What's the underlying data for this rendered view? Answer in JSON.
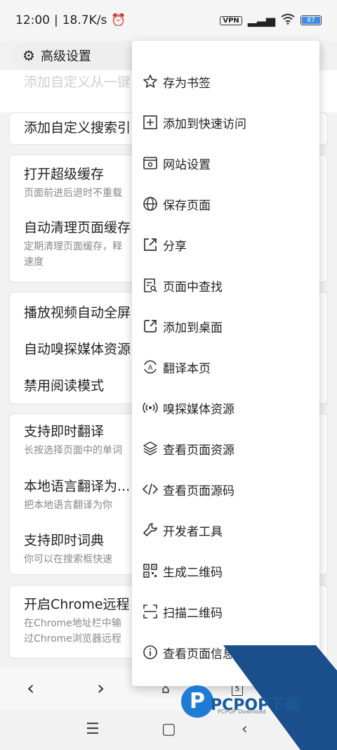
{
  "status": {
    "time": "12:00",
    "net_speed": "18.7K/s",
    "vpn": "VPN",
    "battery": "87"
  },
  "header": {
    "title": "高级设置"
  },
  "behind_text": "添加自定义从一键",
  "settings": {
    "add_search": {
      "title": "添加自定义搜索引"
    },
    "super_cache": {
      "title": "打开超级缓存",
      "sub": "页面前进后退时不重载"
    },
    "auto_clean": {
      "title": "自动清理页面缓存",
      "sub1": "定期清理页面缓存，释",
      "sub2": "速度"
    },
    "fullscreen": {
      "title": "播放视频自动全屏"
    },
    "sniff": {
      "title": "自动嗅探媒体资源"
    },
    "reader": {
      "title": "禁用阅读模式"
    },
    "instant_translate": {
      "title": "支持即时翻译",
      "sub": "长按选择页面中的单词"
    },
    "local_translate": {
      "title": "本地语言翻译为...",
      "sub": "把本地语言翻译为你"
    },
    "dictionary": {
      "title": "支持即时词典",
      "sub": "你可以在搜索框快速"
    },
    "chrome_remote": {
      "title": "开启Chrome远程",
      "sub1": "在Chrome地址栏中输",
      "sub2": "过Chrome浏览器远程"
    }
  },
  "menu": {
    "items": [
      {
        "label": "存为书签",
        "icon": "star-plus-icon"
      },
      {
        "label": "添加到快速访问",
        "icon": "square-plus-icon"
      },
      {
        "label": "网站设置",
        "icon": "browser-gear-icon"
      },
      {
        "label": "保存页面",
        "icon": "globe-download-icon"
      },
      {
        "label": "分享",
        "icon": "share-icon"
      },
      {
        "label": "页面中查找",
        "icon": "doc-search-icon"
      },
      {
        "label": "添加到桌面",
        "icon": "add-desktop-icon"
      },
      {
        "label": "翻译本页",
        "icon": "translate-icon"
      },
      {
        "label": "嗅探媒体资源",
        "icon": "broadcast-icon"
      },
      {
        "label": "查看页面资源",
        "icon": "layers-icon"
      },
      {
        "label": "查看页面源码",
        "icon": "code-icon"
      },
      {
        "label": "开发者工具",
        "icon": "wrench-icon"
      },
      {
        "label": "生成二维码",
        "icon": "qrcode-icon"
      },
      {
        "label": "扫描二维码",
        "icon": "scan-icon"
      },
      {
        "label": "查看页面信息",
        "icon": "info-icon"
      }
    ]
  },
  "bottom_nav": {
    "tab_count": "5"
  },
  "watermark": {
    "brand": "PCPOP下载",
    "sub": "PCPOP Download",
    "logo_letter": "P"
  }
}
